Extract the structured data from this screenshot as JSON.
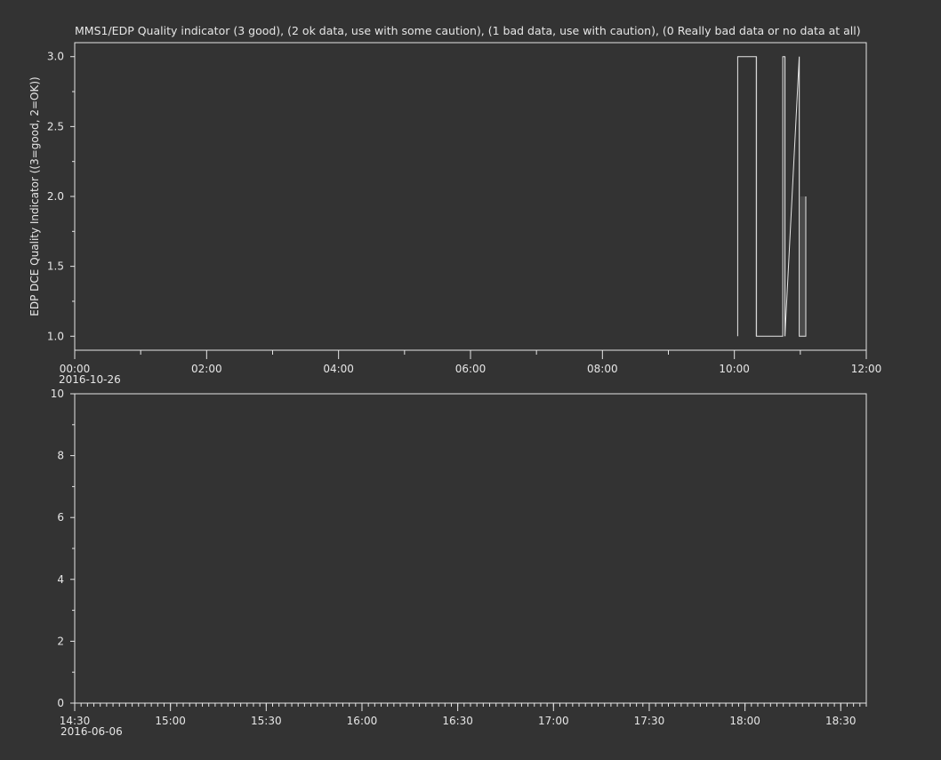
{
  "page": {
    "background": "#333333",
    "foreground": "#e6e6e6"
  },
  "chart_data": [
    {
      "type": "line",
      "title": "MMS1/EDP  Quality indicator (3 good), (2 ok data, use with some caution), (1 bad data, use with caution), (0 Really bad data or no data at all)",
      "ylabel": "EDP DCE Quality Indicator ((3=good, 2=OK))",
      "xlabel": "",
      "x_date_label": "2016-10-26",
      "xlim": [
        "00:00",
        "12:00"
      ],
      "ylim": [
        0.9,
        3.1
      ],
      "x_ticks": [
        "00:00",
        "02:00",
        "04:00",
        "06:00",
        "08:00",
        "10:00",
        "12:00"
      ],
      "y_ticks": [
        "1.0",
        "1.5",
        "2.0",
        "2.5",
        "3.0"
      ],
      "line_color": "#e6e6e6",
      "series": [
        {
          "x": [
            "10:03",
            "10:03",
            "10:20",
            "10:20",
            "10:44",
            "10:44",
            "10:46",
            "10:46",
            "10:59",
            "10:59",
            "11:05",
            "11:05"
          ],
          "values": [
            1.0,
            3.0,
            3.0,
            1.0,
            1.0,
            3.0,
            3.0,
            1.0,
            3.0,
            1.0,
            1.0,
            2.0
          ]
        }
      ],
      "filled_spans": [
        {
          "x": [
            "10:19",
            "10:21"
          ],
          "values": [
            1.0,
            3.0
          ]
        },
        {
          "x": [
            "10:46",
            "10:47"
          ],
          "values": [
            1.0,
            3.0
          ]
        },
        {
          "x": [
            "10:59",
            "11:05"
          ],
          "values": [
            1.0,
            2.0
          ]
        },
        {
          "x": [
            "10:59",
            "11:00"
          ],
          "values": [
            1.0,
            3.0
          ]
        }
      ],
      "fill_color": "#4a4a4a",
      "grid": false
    },
    {
      "type": "line",
      "title": "",
      "ylabel": "",
      "xlabel": "",
      "x_date_label": "2016-06-06",
      "xlim": [
        "14:30",
        "18:38"
      ],
      "ylim": [
        0,
        10
      ],
      "x_ticks": [
        "14:30",
        "15:00",
        "15:30",
        "16:00",
        "16:30",
        "17:00",
        "17:30",
        "18:00",
        "18:30"
      ],
      "y_ticks": [
        "0",
        "2",
        "4",
        "6",
        "8",
        "10"
      ],
      "series": [],
      "grid": false
    }
  ]
}
